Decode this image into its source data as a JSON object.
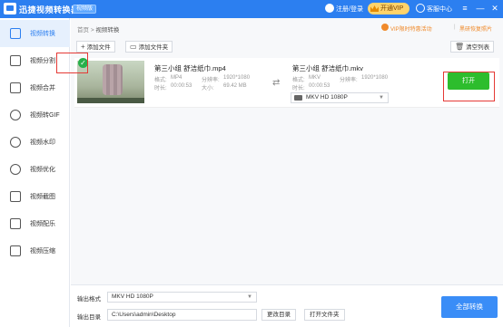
{
  "app": {
    "title": "迅捷视频转换器",
    "badge": "视频版",
    "login": "注册/登录",
    "vip": "开通VIP",
    "help": "客服中心"
  },
  "sidebar": {
    "items": [
      {
        "label": "视频转换",
        "icon": "convert-icon",
        "active": true
      },
      {
        "label": "视频分割",
        "icon": "split-icon"
      },
      {
        "label": "视频合并",
        "icon": "merge-icon"
      },
      {
        "label": "视频转GIF",
        "icon": "gif-icon"
      },
      {
        "label": "视频水印",
        "icon": "watermark-icon"
      },
      {
        "label": "视频优化",
        "icon": "optimize-icon"
      },
      {
        "label": "视频截图",
        "icon": "screenshot-icon"
      },
      {
        "label": "视频配乐",
        "icon": "music-icon"
      },
      {
        "label": "视频压缩",
        "icon": "compress-icon"
      }
    ]
  },
  "main": {
    "breadcrumb_home": "首页",
    "breadcrumb_sep": ">",
    "breadcrumb_current": "视频转换",
    "vip_tip": "VIP限时特惠活动",
    "tip_sep": "|",
    "restore_tip": "黑研恢复照片"
  },
  "toolbar": {
    "add_file": "添加文件",
    "add_folder": "添加文件夹",
    "clear_list": "清空列表"
  },
  "file": {
    "source": {
      "name": "第三小组 舒洁纸巾.mp4",
      "format_label": "格式:",
      "format": "MP4",
      "resolution_label": "分辨率:",
      "resolution": "1920*1080",
      "duration_label": "时长:",
      "duration": "00:00:53",
      "size_label": "大小:",
      "size": "69.42 MB"
    },
    "target": {
      "name": "第三小组 舒洁纸巾.mkv",
      "format_label": "格式:",
      "format": "MKV",
      "resolution_label": "分辨率:",
      "resolution": "1920*1080",
      "duration_label": "时长:",
      "duration": "00:00:53",
      "output_format": "MKV  HD 1080P"
    },
    "open_button": "打开"
  },
  "bottom": {
    "output_format_label": "输出格式",
    "output_format": "MKV  HD 1080P",
    "output_dir_label": "输出目录",
    "output_dir": "C:\\Users\\admin\\Desktop",
    "change_dir": "更改目录",
    "open_folder": "打开文件夹",
    "convert_all": "全部转换"
  },
  "colors": {
    "brand": "#2c7ff0",
    "open_button": "#2dbd2d",
    "warning": "#f08a2b",
    "highlight": "#e53935"
  }
}
